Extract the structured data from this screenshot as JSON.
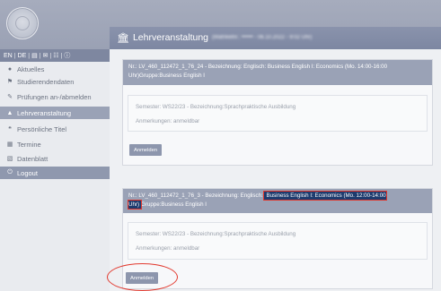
{
  "header": {
    "title": "Lehrveranstaltung",
    "meta": "(Matrikelnr.: •••••• - 06.10.2022 - 9:02 Uhr)",
    "title_icon": "building-columns-icon",
    "logo": "university-seal-logo"
  },
  "toolbar": {
    "lang_en": "EN",
    "lang_de": "DE",
    "sep": "|",
    "icons": [
      "clipboard-icon",
      "envelope-icon",
      "sitemap-icon",
      "info-icon"
    ]
  },
  "sidebar": {
    "items": [
      {
        "label": "Aktuelles",
        "icon": "chat-bubble-icon"
      },
      {
        "label": "Studierendendaten",
        "icon": "flag-icon"
      },
      {
        "label": "Prüfungen an-/abmelden",
        "icon": "edit-icon"
      },
      {
        "label": "Lehrveranstaltung",
        "icon": "building-columns-icon",
        "active": true
      },
      {
        "label": "Persönliche Titel",
        "icon": "quote-icon"
      },
      {
        "label": "Termine",
        "icon": "calendar-icon"
      },
      {
        "label": "Datenblatt",
        "icon": "table-icon"
      },
      {
        "label": "Logout",
        "icon": "power-icon"
      }
    ]
  },
  "courses": [
    {
      "header_text": "Nr.: LV_460_112472_1_76_24 - Bezeichnung: Englisch: Business English I: Economics (Mo. 14:00-16:00 Uhr)Gruppe:Business English I",
      "semester": "Semester: WS22/23 - Bezeichnung:Sprachpraktische Ausbildung",
      "note": "Anmerkungen: anmeldbar",
      "button": "Anmelden"
    },
    {
      "header_prefix": "Nr.: LV_460_112472_1_76_3 - Bezeichnung: Englisch: ",
      "header_highlight": "Business English I: Economics (Mo. 12:00-14:00 Uhr)",
      "header_suffix": "Gruppe:Business English I",
      "semester": "Semester: WS22/23 - Bezeichnung:Sprachpraktische Ausbildung",
      "note": "Anmerkungen: anmeldbar",
      "button": "Anmelden"
    }
  ],
  "colors": {
    "banner": "#9aa1b4",
    "header_bar": "#8a93ac",
    "highlight": "#1d3b6e",
    "annotation": "#e23a2f"
  }
}
